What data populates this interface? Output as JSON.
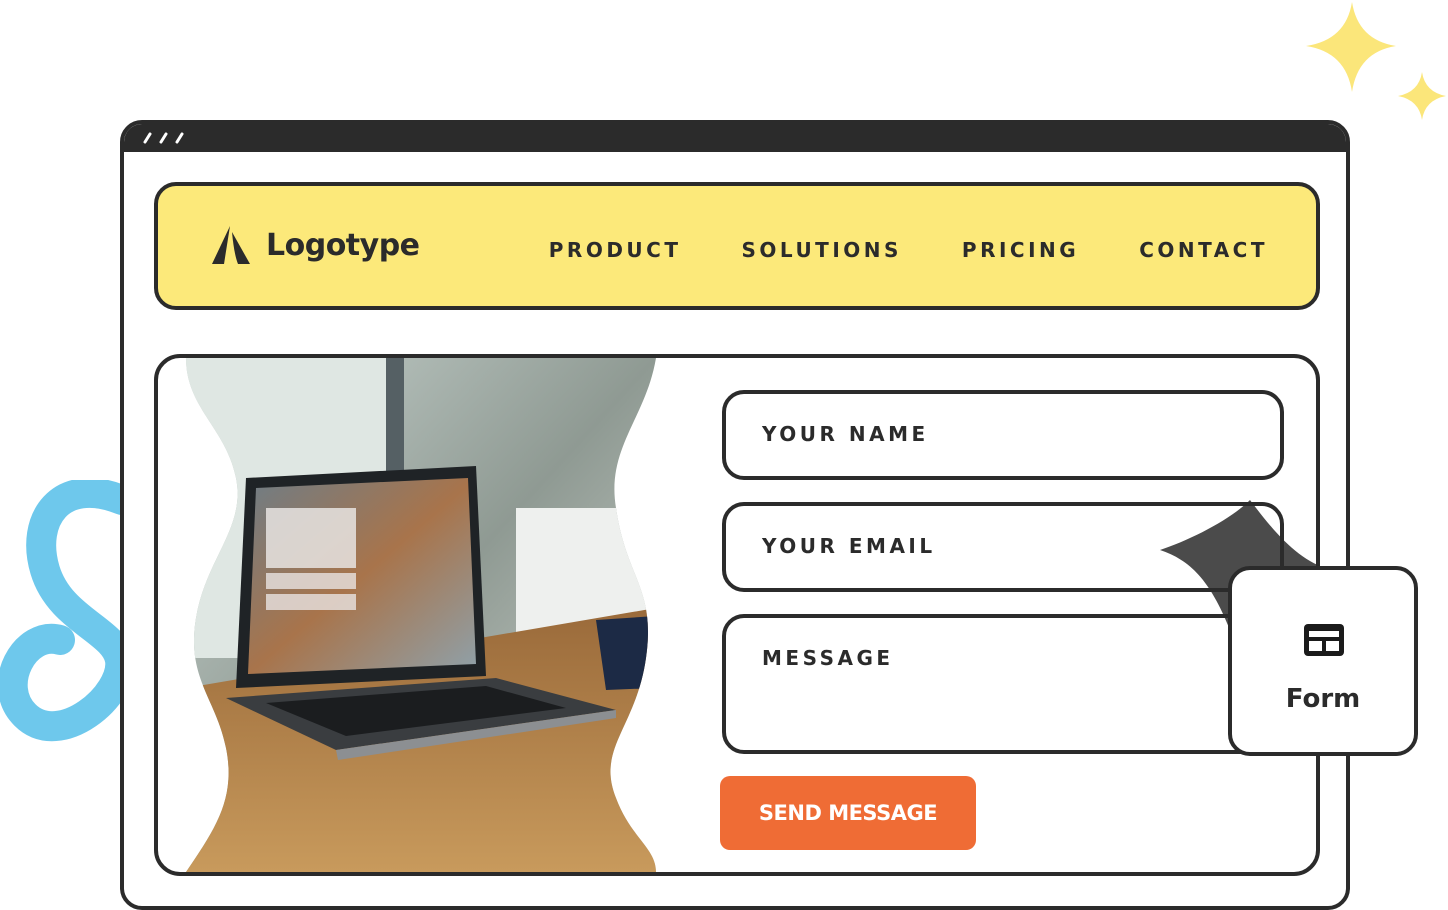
{
  "brand": {
    "name": "Logotype",
    "logo_icon": "logo-mark-icon"
  },
  "nav": {
    "items": [
      {
        "label": "PRODUCT"
      },
      {
        "label": "SOLUTIONS"
      },
      {
        "label": "PRICING"
      },
      {
        "label": "CONTACT"
      }
    ]
  },
  "form": {
    "fields": [
      {
        "label": "YOUR NAME"
      },
      {
        "label": "YOUR EMAIL"
      },
      {
        "label": "MESSAGE"
      }
    ],
    "submit_label": "SEND MESSAGE"
  },
  "badge": {
    "label": "Form",
    "icon": "form-layout-icon"
  },
  "colors": {
    "nav_bg": "#fce97a",
    "outline": "#2b2b2b",
    "button": "#ef6c35",
    "sparkle": "#fbe67a",
    "squiggle": "#6ec8ec"
  }
}
